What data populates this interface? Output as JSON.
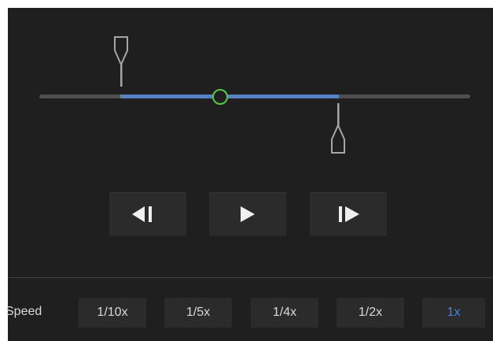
{
  "player": {
    "colors": {
      "panel_bg": "#1f1f1f",
      "track": "#4f4f4f",
      "range": "#5682c4",
      "position_ring": "#58c84a",
      "active_speed": "#4d7fe0",
      "text": "#d9d9d9"
    },
    "timeline": {
      "range_start_fraction": 0.19,
      "range_end_fraction": 0.7,
      "position_fraction": 0.41
    },
    "controls": [
      {
        "name": "previous-frame",
        "icon": "step-backward-icon"
      },
      {
        "name": "play",
        "icon": "play-icon"
      },
      {
        "name": "next-frame",
        "icon": "step-forward-icon"
      }
    ]
  },
  "speed": {
    "label": "Speed",
    "options": [
      "1/10x",
      "1/5x",
      "1/4x",
      "1/2x",
      "1x"
    ],
    "selected": "1x"
  }
}
